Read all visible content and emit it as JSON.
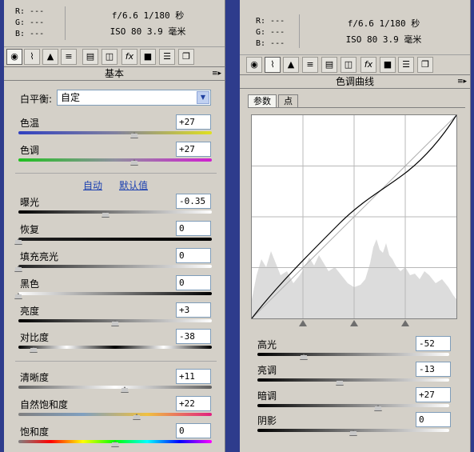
{
  "readout": {
    "r": "R:  ---",
    "g": "G:  ---",
    "b": "B:  ---",
    "exif_line1": "f/6.6  1/180 秒",
    "exif_line2": "ISO 80  3.9 毫米"
  },
  "left": {
    "section_title": "基本",
    "white_balance": {
      "label": "白平衡:",
      "value": "自定"
    },
    "temperature": {
      "label": "色温",
      "value": "+27",
      "level": 0.6
    },
    "tint": {
      "label": "色调",
      "value": "+27",
      "level": 0.6
    },
    "links": {
      "auto": "自动",
      "default": "默认值"
    },
    "exposure": {
      "label": "曝光",
      "value": "-0.35",
      "level": 0.45
    },
    "recovery": {
      "label": "恢复",
      "value": "0",
      "level": 0.0
    },
    "fill_light": {
      "label": "填充亮光",
      "value": "0",
      "level": 0.0
    },
    "blacks": {
      "label": "黑色",
      "value": "0",
      "level": 0.0
    },
    "brightness": {
      "label": "亮度",
      "value": "+3",
      "level": 0.5
    },
    "contrast": {
      "label": "对比度",
      "value": "-38",
      "level": 0.08
    },
    "clarity": {
      "label": "清晰度",
      "value": "+11",
      "level": 0.55
    },
    "vibrance": {
      "label": "自然饱和度",
      "value": "+22",
      "level": 0.61
    },
    "saturation": {
      "label": "饱和度",
      "value": "0",
      "level": 0.5
    }
  },
  "right": {
    "section_title": "色调曲线",
    "tab_param": "参数",
    "tab_point": "点",
    "highlights": {
      "label": "高光",
      "value": "-52",
      "level": 0.24
    },
    "lights": {
      "label": "亮调",
      "value": "-13",
      "level": 0.43
    },
    "darks": {
      "label": "暗调",
      "value": "+27",
      "level": 0.63
    },
    "shadows": {
      "label": "阴影",
      "value": "0",
      "level": 0.5
    }
  },
  "icons": [
    "aperture-icon",
    "curve-icon",
    "mountain-icon",
    "detail-icon",
    "hsl-icon",
    "split-icon",
    "fx-icon",
    "camera-icon",
    "presets-icon",
    "snapshot-icon"
  ]
}
